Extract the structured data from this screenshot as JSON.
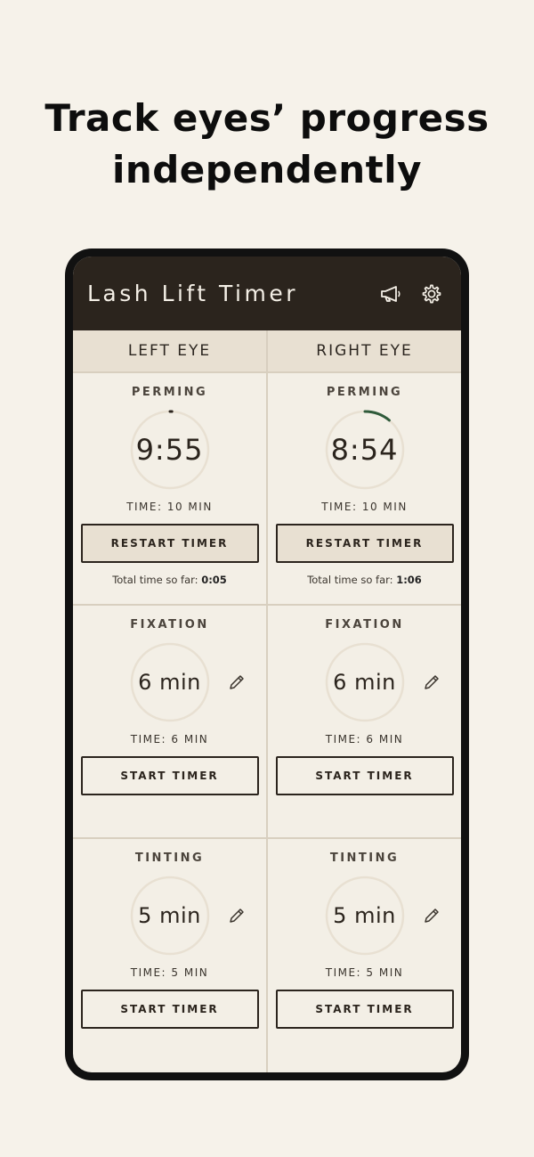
{
  "headline": {
    "line1": "Track eyes’ progress",
    "line2": "independently"
  },
  "app": {
    "title": "Lash Lift Timer",
    "icons": [
      "megaphone-icon",
      "gear-icon"
    ]
  },
  "columns": [
    {
      "header": "LEFT EYE",
      "steps": [
        {
          "title": "PERMING",
          "display": "9:55",
          "time": "TIME: 10 MIN",
          "button": "RESTART TIMER",
          "total_label": "Total time so far:",
          "total_value": "0:05",
          "progress": 0.008
        },
        {
          "title": "FIXATION",
          "display": "6 min",
          "time": "TIME: 6 MIN",
          "button": "START TIMER"
        },
        {
          "title": "TINTING",
          "display": "5 min",
          "time": "TIME: 5 MIN",
          "button": "START TIMER"
        }
      ]
    },
    {
      "header": "RIGHT EYE",
      "steps": [
        {
          "title": "PERMING",
          "display": "8:54",
          "time": "TIME: 10 MIN",
          "button": "RESTART TIMER",
          "total_label": "Total time so far:",
          "total_value": "1:06",
          "progress": 0.11
        },
        {
          "title": "FIXATION",
          "display": "6 min",
          "time": "TIME: 6 MIN",
          "button": "START TIMER"
        },
        {
          "title": "TINTING",
          "display": "5 min",
          "time": "TIME: 5 MIN",
          "button": "START TIMER"
        }
      ]
    }
  ],
  "colors": {
    "accent": "#2f5a3a",
    "ring": "#e8e0d2",
    "bar": "#2b241d",
    "background": "#f6f2ea"
  }
}
